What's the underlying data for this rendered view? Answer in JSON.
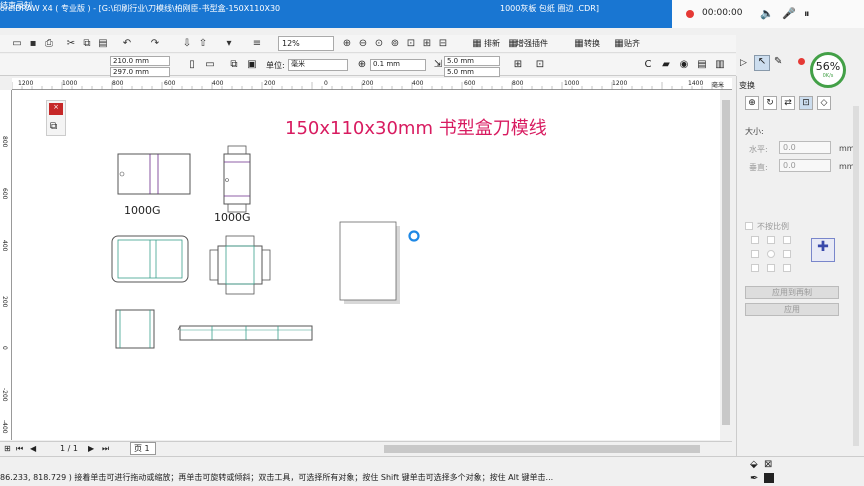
{
  "window": {
    "title": "oreIDRAW X4 ( 专业版 ) - [G:\\印刷行业\\刀模线\\柏刚臣-书型盒-150X110X30",
    "extra": "1000灰板    包纸    圈边 .CDR]"
  },
  "recorder": {
    "time": "00:00:00",
    "stop_label": "结束录制"
  },
  "toolbar": {
    "zoom": "12%",
    "paibian": "排新",
    "enhance": "增强插件",
    "convert": "转换",
    "align": "贴齐"
  },
  "propbar": {
    "width": "210.0 mm",
    "height": "297.0 mm",
    "unit_label": "单位:",
    "unit_value": "毫米",
    "nudge": "0.1 mm",
    "dup_x": "5.0 mm",
    "dup_y": "5.0 mm"
  },
  "ruler": {
    "h_ticks": [
      "1200",
      "1000",
      "800",
      "600",
      "400",
      "200",
      "0",
      "200",
      "400",
      "600",
      "800",
      "1000",
      "1200",
      "1400"
    ],
    "h_unit": "毫米",
    "v_ticks": [
      "800",
      "600",
      "400",
      "200",
      "0",
      "-200",
      "-400"
    ]
  },
  "canvas": {
    "heading": "150x110x30mm  书型盒刀模线",
    "captions": [
      "1000G",
      "1000G"
    ]
  },
  "pagebar": {
    "page_info": "1 / 1",
    "page_tab": "页 1"
  },
  "status": {
    "text": "86.233, 818.729 ) 接着单击可进行拖动或缩放；再单击可旋转或倾斜；双击工具，可选择所有对象；按住 Shift 键单击可选择多个对象；按住 Alt 键单击..."
  },
  "docker": {
    "title": "变换",
    "size_label": "大小:",
    "h_label": "水平:",
    "v_label": "垂直:",
    "h_value": "0.0",
    "v_value": "0.0",
    "unit": "mm",
    "proportional": "不按比例",
    "apply_copy": "应用到再制",
    "apply": "应用"
  },
  "network": {
    "percent": "56%",
    "speed": "0K/s"
  },
  "colors": {
    "title_bar": "#1976d2",
    "heading": "#d81b60",
    "dieline_teal": "#3aa08c",
    "dieline_purple": "#6a2a8a"
  }
}
